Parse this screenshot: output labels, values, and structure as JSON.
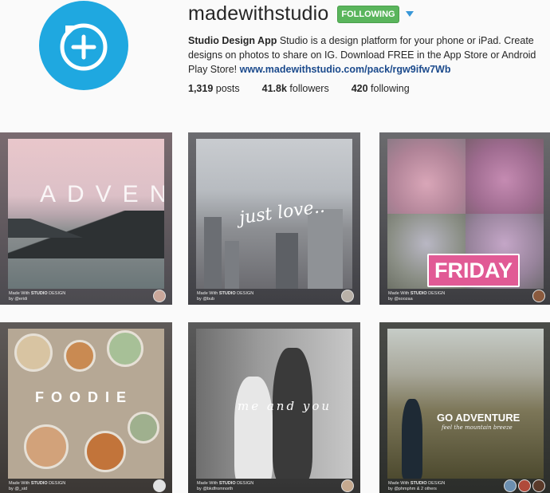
{
  "profile": {
    "username": "madewithstudio",
    "follow_label": "FOLLOWING",
    "bio_name": "Studio Design App",
    "bio_text": " Studio is a design platform for your phone or iPad. Create designs on photos to share on IG. Download FREE in the App Store or Android Play Store! ",
    "bio_link": "www.madewithstudio.com/pack/rgw9ifw7Wb",
    "stats": [
      {
        "value": "1,319",
        "label": " posts"
      },
      {
        "value": "41.8k",
        "label": " followers"
      },
      {
        "value": "420",
        "label": " following"
      }
    ],
    "avatar_color": "#1fa8e0",
    "follow_color": "#5ab55c"
  },
  "posts": [
    {
      "overlay": "ADVENTURE",
      "caption_pre": "Made With ",
      "caption_brand": "STUDIO",
      "caption_post": " DESIGN",
      "author": "by @eridi"
    },
    {
      "overlay": "just love..",
      "caption_pre": "Made With ",
      "caption_brand": "STUDIO",
      "caption_post": " DESIGN",
      "author": "by @bub"
    },
    {
      "overlay": "FRIDAY",
      "caption_pre": "Made With ",
      "caption_brand": "STUDIO",
      "caption_post": " DESIGN",
      "author": "by @soozaa"
    },
    {
      "overlay": "FOODIE",
      "caption_pre": "Made With ",
      "caption_brand": "STUDIO",
      "caption_post": " DESIGN",
      "author": "by @_sid"
    },
    {
      "overlay": "me and you",
      "caption_pre": "Made With ",
      "caption_brand": "STUDIO",
      "caption_post": " DESIGN",
      "author": "by @bkdfromnorth"
    },
    {
      "overlay": "GO ADVENTURE",
      "overlay_sub": "feel the mountain breeze",
      "caption_pre": "Made With ",
      "caption_brand": "STUDIO",
      "caption_post": " DESIGN",
      "author": "by @phmphm & 2 others"
    }
  ]
}
